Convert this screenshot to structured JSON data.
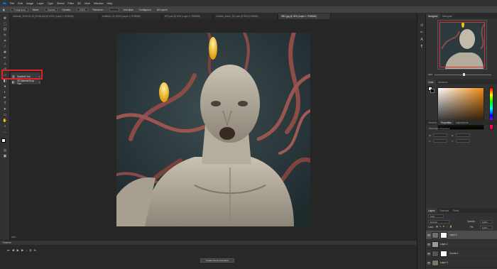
{
  "menu": {
    "app_badge": "Ps",
    "items": [
      "File",
      "Edit",
      "Image",
      "Layer",
      "Type",
      "Select",
      "Filter",
      "3D",
      "View",
      "Window",
      "Help"
    ]
  },
  "options_bar": {
    "sample": "Foreground",
    "mode_label": "Mode:",
    "mode_value": "Normal",
    "opacity_label": "Opacity:",
    "opacity_value": "100%",
    "tolerance_label": "Tolerance:",
    "anti_alias": "Anti-alias",
    "contiguous": "Contiguous",
    "all_layers": "All Layers"
  },
  "tabs": [
    {
      "label": "Ultimate_2049-02-15_09-36.psd @ 100% (Layer 1, RGB/8#)",
      "active": false
    },
    {
      "label": "Untitled-1 @ 100% (Layer 1, RGB/8#)",
      "active": false
    },
    {
      "label": "SF0.psd @ 50% (Layer 1, RGB/8#)",
      "active": false
    },
    {
      "label": "Zombie_scene_001.psd @ 50% (RGB/8#)",
      "active": false
    },
    {
      "label": "SBC.jpg @ 33% (Layer 1, RGB/8#)",
      "active": true
    }
  ],
  "flyout": {
    "items": [
      {
        "label": "Gradient Tool",
        "key": "G"
      },
      {
        "label": "3D Material Drop Tool",
        "key": "G"
      }
    ]
  },
  "status": {
    "zoom": "33%"
  },
  "timeline": {
    "title": "Timeline",
    "create_button": "Create Frame Animation"
  },
  "right_panel": {
    "nav_tabs": [
      "Navigator",
      "Histogram"
    ],
    "nav_zoom": "33%",
    "color_tabs": [
      "Color",
      "Swatches"
    ],
    "props_tabs": [
      "Libraries",
      "Properties",
      "Adjustments"
    ],
    "props_title": "Pixel Layer Properties",
    "props_fields": {
      "w": "W:",
      "h": "H:",
      "x": "X:",
      "y": "Y:"
    },
    "layers_tabs": [
      "Layers",
      "Channels",
      "Paths"
    ],
    "kind_label": "Kind",
    "blend_mode": "Normal",
    "opacity_label": "Opacity:",
    "opacity_value": "100%",
    "lock_label": "Lock:",
    "fill_label": "Fill:",
    "fill_value": "100%",
    "layers": [
      {
        "name": "Layer 1",
        "selected": true,
        "masked": true
      },
      {
        "name": "Layer 2",
        "selected": false,
        "masked": false
      },
      {
        "name": "Curves 1",
        "selected": false,
        "masked": true
      },
      {
        "name": "Layer 0",
        "selected": false,
        "masked": false
      }
    ]
  },
  "colors": {
    "highlight": "#d8252b",
    "accent": "#31a8ff",
    "swatch": "#f08a15"
  }
}
